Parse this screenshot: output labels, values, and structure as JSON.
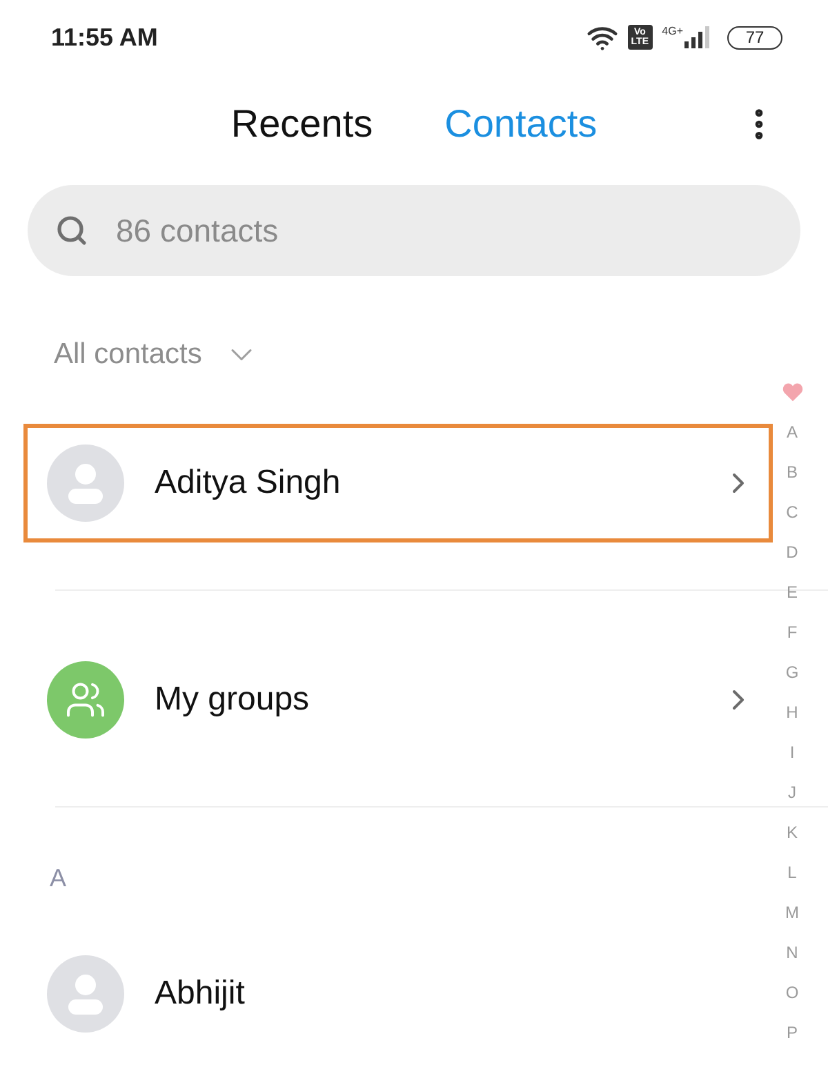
{
  "status_bar": {
    "time": "11:55 AM",
    "volte": "Vo LTE",
    "network_type": "4G+",
    "battery": "77"
  },
  "tabs": [
    {
      "label": "Recents",
      "selected": false
    },
    {
      "label": "Contacts",
      "selected": true
    }
  ],
  "search": {
    "placeholder": "86 contacts"
  },
  "filter": {
    "label": "All contacts"
  },
  "pinned": [
    {
      "kind": "contact",
      "name": "Aditya Singh",
      "highlighted": true
    },
    {
      "kind": "groups",
      "name": "My groups",
      "highlighted": false
    }
  ],
  "sections": [
    {
      "letter": "A",
      "contacts": [
        {
          "name": "Abhijit"
        }
      ]
    }
  ],
  "index": [
    {
      "kind": "favorites"
    },
    {
      "kind": "letter",
      "label": "A"
    },
    {
      "kind": "letter",
      "label": "B"
    },
    {
      "kind": "letter",
      "label": "C"
    },
    {
      "kind": "letter",
      "label": "D"
    },
    {
      "kind": "letter",
      "label": "E"
    },
    {
      "kind": "letter",
      "label": "F"
    },
    {
      "kind": "letter",
      "label": "G"
    },
    {
      "kind": "letter",
      "label": "H"
    },
    {
      "kind": "letter",
      "label": "I"
    },
    {
      "kind": "letter",
      "label": "J"
    },
    {
      "kind": "letter",
      "label": "K"
    },
    {
      "kind": "letter",
      "label": "L"
    },
    {
      "kind": "letter",
      "label": "M"
    },
    {
      "kind": "letter",
      "label": "N"
    },
    {
      "kind": "letter",
      "label": "O"
    },
    {
      "kind": "letter",
      "label": "P"
    }
  ]
}
